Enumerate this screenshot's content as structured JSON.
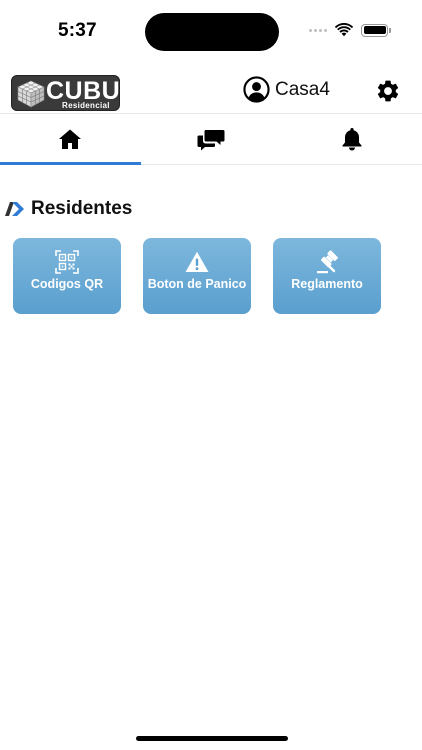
{
  "status_bar": {
    "time": "5:37"
  },
  "header": {
    "logo_text": "CUBU",
    "logo_subtext": "Residencial",
    "user_name": "Casa4",
    "icons": {
      "user": "user-circle-icon",
      "settings": "gear-icon"
    }
  },
  "tabs": [
    {
      "icon": "home-icon",
      "active": true
    },
    {
      "icon": "chat-bubbles-icon",
      "active": false
    },
    {
      "icon": "bell-icon",
      "active": false
    }
  ],
  "section": {
    "title": "Residentes",
    "icon": "double-chevron-right-icon"
  },
  "cards": [
    {
      "label": "Codigos QR",
      "icon": "qr-code-icon"
    },
    {
      "label": "Boton de Panico",
      "icon": "warning-triangle-icon"
    },
    {
      "label": "Reglamento",
      "icon": "gavel-icon"
    }
  ],
  "colors": {
    "accent": "#2f7bd6",
    "card_gradient_top": "#7db7dc",
    "card_gradient_bottom": "#5a9fcf",
    "logo_bg": "#3a3a3a"
  }
}
